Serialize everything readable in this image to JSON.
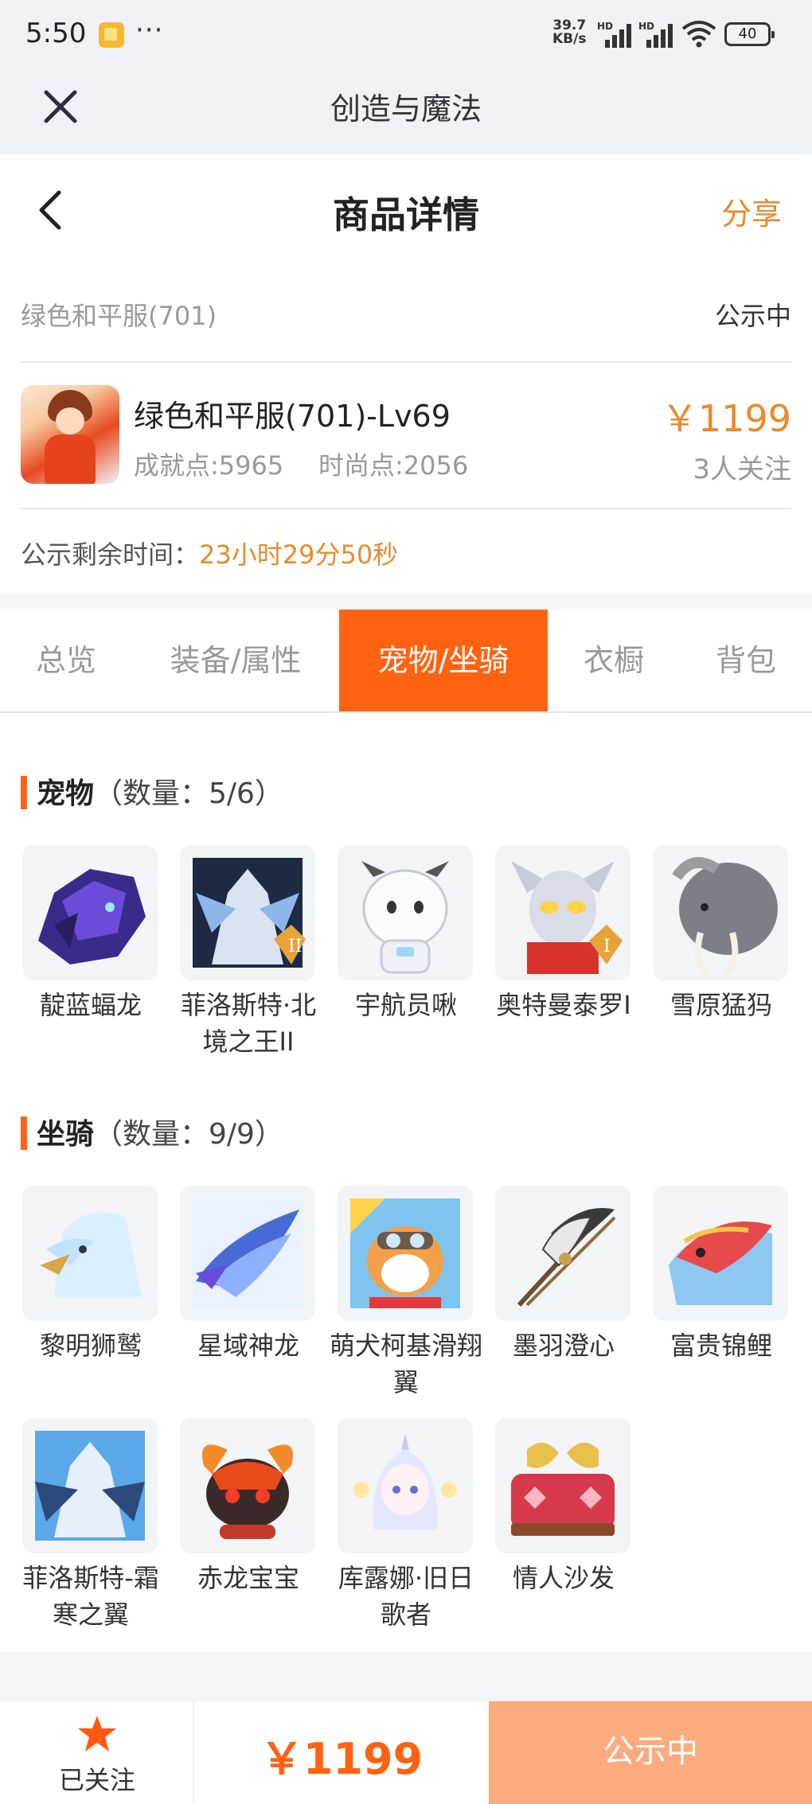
{
  "status_bar": {
    "time": "5:50",
    "more": "···",
    "speed_value": "39.7",
    "speed_unit": "KB/s",
    "signal_label": "HD",
    "battery": "40"
  },
  "window": {
    "title": "创造与魔法"
  },
  "header": {
    "title": "商品详情",
    "share_label": "分享"
  },
  "summary": {
    "server_name": "绿色和平服(701)",
    "status": "公示中",
    "character_name": "绿色和平服(701)-Lv69",
    "achievement": "成就点:5965",
    "fashion": "时尚点:2056",
    "price": "￥1199",
    "followers": "3人关注",
    "remaining_label": "公示剩余时间：",
    "remaining_value": "23小时29分50秒"
  },
  "tabs": [
    {
      "label": "总览"
    },
    {
      "label": "装备/属性"
    },
    {
      "label": "宠物/坐骑",
      "active": true
    },
    {
      "label": "衣橱"
    },
    {
      "label": "背包"
    }
  ],
  "pets": {
    "title": "宠物",
    "count": "（数量：5/6）",
    "items": [
      {
        "name": "靛蓝蝠龙",
        "icon": "indigo-bat-dragon-icon"
      },
      {
        "name": "菲洛斯特·北境之王II",
        "icon": "philost-north-king-icon"
      },
      {
        "name": "宇航员啾",
        "icon": "astronaut-chick-icon"
      },
      {
        "name": "奥特曼泰罗I",
        "icon": "ultraman-taro-icon"
      },
      {
        "name": "雪原猛犸",
        "icon": "snow-mammoth-icon"
      }
    ]
  },
  "mounts": {
    "title": "坐骑",
    "count": "（数量：9/9）",
    "items": [
      {
        "name": "黎明狮鹫",
        "icon": "dawn-griffin-icon"
      },
      {
        "name": "星域神龙",
        "icon": "star-dragon-icon"
      },
      {
        "name": "萌犬柯基滑翔翼",
        "icon": "corgi-glider-icon"
      },
      {
        "name": "墨羽澄心",
        "icon": "ink-feather-icon"
      },
      {
        "name": "富贵锦鲤",
        "icon": "koi-fish-icon"
      },
      {
        "name": "菲洛斯特-霜寒之翼",
        "icon": "philost-frost-wing-icon"
      },
      {
        "name": "赤龙宝宝",
        "icon": "red-dragon-baby-icon"
      },
      {
        "name": "库露娜·旧日歌者",
        "icon": "kuluna-singer-icon"
      },
      {
        "name": "情人沙发",
        "icon": "lover-sofa-icon"
      }
    ]
  },
  "bottom_bar": {
    "follow_label": "已关注",
    "price": "￥1199",
    "action_label": "公示中"
  },
  "colors": {
    "accent": "#ff6210",
    "price": "#e98a2c",
    "action_button": "#fcab7e"
  }
}
